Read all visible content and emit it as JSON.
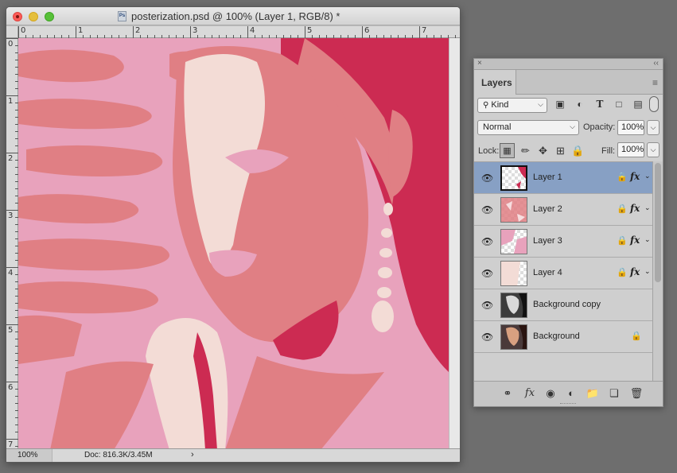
{
  "document": {
    "title": "posterization.psd @ 100% (Layer 1, RGB/8) *",
    "file_icon": "Ps",
    "ruler_h_labels": [
      "0",
      "1",
      "2",
      "3",
      "4",
      "5",
      "6",
      "7"
    ],
    "ruler_v_labels": [
      "0",
      "1",
      "2",
      "3",
      "4",
      "5",
      "6",
      "7"
    ],
    "status": {
      "zoom": "100%",
      "doc_size": "Doc: 816.3K/3.45M",
      "arrow": "›"
    },
    "poster_colors": {
      "light_pink": "#e8a2bc",
      "salmon": "#e07f84",
      "cream": "#f3dcd6",
      "crimson": "#cc2b52"
    }
  },
  "layers_panel": {
    "close_glyph": "×",
    "collapse_glyph": "‹‹",
    "tab_label": "Layers",
    "menu_glyph": "≡",
    "filter_kind": "Kind",
    "blend_mode": "Normal",
    "opacity_label": "Opacity:",
    "opacity_value": "100%",
    "lock_label": "Lock:",
    "fill_label": "Fill:",
    "fill_value": "100%",
    "layers": [
      {
        "name": "Layer 1",
        "selected": true,
        "locked": true,
        "fx": "fx"
      },
      {
        "name": "Layer 2",
        "selected": false,
        "locked": true,
        "fx": "fx"
      },
      {
        "name": "Layer 3",
        "selected": false,
        "locked": true,
        "fx": "fx"
      },
      {
        "name": "Layer 4",
        "selected": false,
        "locked": true,
        "fx": "fx"
      },
      {
        "name": "Background copy",
        "selected": false,
        "locked": false,
        "fx": ""
      },
      {
        "name": "Background",
        "selected": false,
        "locked": true,
        "fx": ""
      }
    ],
    "footer_icons": [
      "link-icon",
      "fx-icon",
      "mask-icon",
      "adjustment-icon",
      "folder-icon",
      "new-layer-icon",
      "trash-icon"
    ]
  }
}
